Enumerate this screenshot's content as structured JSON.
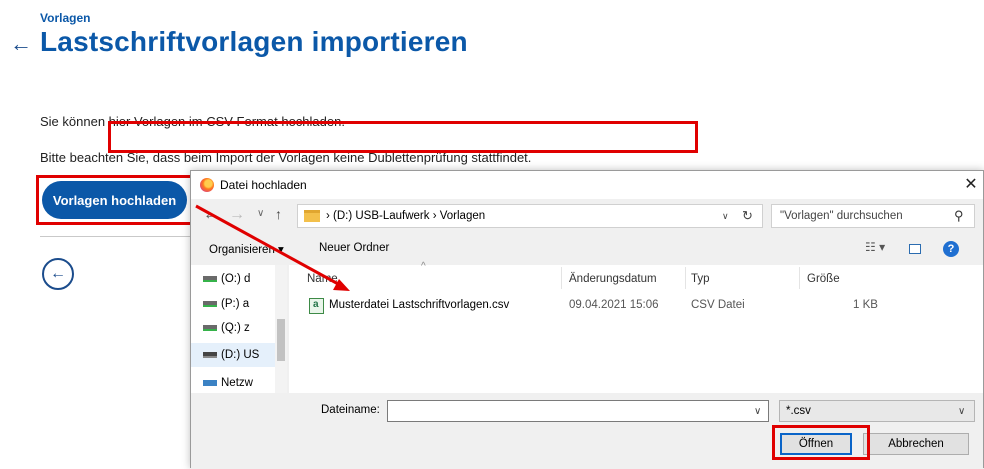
{
  "page": {
    "breadcrumb": "Vorlagen",
    "title": "Lastschriftvorlagen importieren",
    "info_line1": "Sie können hier Vorlagen im CSV-Format hochladen.",
    "info_line2": "Bitte beachten Sie, dass beim Import der Vorlagen keine Dublettenprüfung stattfindet.",
    "upload_button": "Vorlagen hochladen",
    "back_icon": "arrow-left-icon"
  },
  "dialog": {
    "title": "Datei hochladen",
    "close": "✕",
    "address_path": "›  (D:) USB-Laufwerk  ›  Vorlagen",
    "search_placeholder": "\"Vorlagen\" durchsuchen",
    "toolbar": {
      "organize": "Organisieren ▾",
      "new_folder": "Neuer Ordner"
    },
    "nav_items": [
      {
        "label": "(O:) d"
      },
      {
        "label": "(P:) a"
      },
      {
        "label": "(Q:) z"
      },
      {
        "label": "(D:) US"
      },
      {
        "label": "Netzw"
      }
    ],
    "columns": {
      "name": "Name",
      "modified": "Änderungsdatum",
      "type": "Typ",
      "size": "Größe"
    },
    "files": [
      {
        "name": "Musterdatei Lastschriftvorlagen.csv",
        "modified": "09.04.2021 15:06",
        "type": "CSV Datei",
        "size": "1 KB"
      }
    ],
    "filename_label": "Dateiname:",
    "filename_value": "",
    "filter": "*.csv",
    "open_button": "Öffnen",
    "cancel_button": "Abbrechen"
  },
  "colors": {
    "brand_blue": "#0b58a8",
    "highlight_red": "#e00000"
  }
}
